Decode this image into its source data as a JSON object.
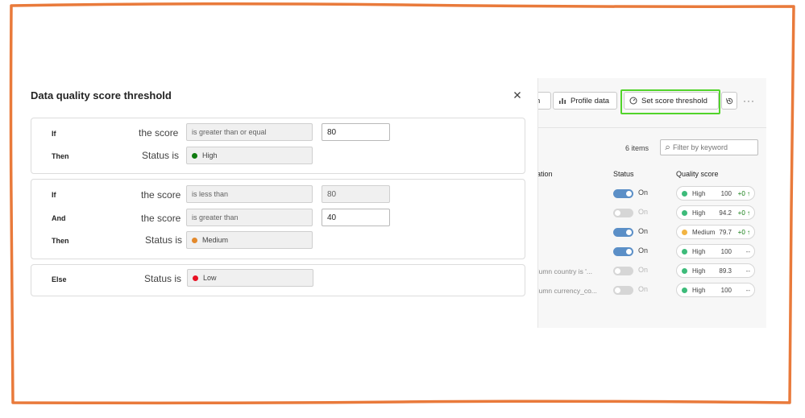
{
  "dialog": {
    "title": "Data quality score threshold",
    "rules": [
      {
        "lines": [
          {
            "keyword": "If",
            "label": "the score",
            "condition": "is greater than or equal",
            "value": "80",
            "value_editable": true
          },
          {
            "keyword": "Then",
            "label": "Status is",
            "status": "High",
            "status_color": "#107c10"
          }
        ]
      },
      {
        "lines": [
          {
            "keyword": "If",
            "label": "the score",
            "condition": "is less than",
            "value": "80",
            "value_editable": false
          },
          {
            "keyword": "And",
            "label": "the score",
            "condition": "is greater than",
            "value": "40",
            "value_editable": true
          },
          {
            "keyword": "Then",
            "label": "Status is",
            "status": "Medium",
            "status_color": "#e3892b"
          }
        ]
      },
      {
        "lines": [
          {
            "keyword": "Else",
            "label": "Status is",
            "status": "Low",
            "status_color": "#e81123"
          }
        ]
      }
    ]
  },
  "background": {
    "toolbar": {
      "partial_button": "n",
      "profile_data": "Profile data",
      "set_score_threshold": "Set score threshold",
      "more": "···"
    },
    "items_count": "6 items",
    "filter_placeholder": "Filter by keyword",
    "columns": {
      "description": "ation",
      "status": "Status",
      "quality_score": "Quality score"
    },
    "rows": [
      {
        "desc": "",
        "on": true,
        "status_text": "On",
        "level": "High",
        "score": "100",
        "trend": "+0 ↑",
        "dot": "#3dbb7a"
      },
      {
        "desc": "",
        "on": false,
        "status_text": "On",
        "level": "High",
        "score": "94.2",
        "trend": "+0 ↑",
        "dot": "#3dbb7a"
      },
      {
        "desc": "",
        "on": true,
        "status_text": "On",
        "level": "Medium",
        "score": "79.7",
        "trend": "+0 ↑",
        "dot": "#f2b443"
      },
      {
        "desc": "",
        "on": true,
        "status_text": "On",
        "level": "High",
        "score": "100",
        "trend": "--",
        "dot": "#3dbb7a"
      },
      {
        "desc": "olumn country is '...",
        "on": false,
        "status_text": "On",
        "level": "High",
        "score": "89.3",
        "trend": "--",
        "dot": "#3dbb7a"
      },
      {
        "desc": "olumn currency_co...",
        "on": false,
        "status_text": "On",
        "level": "High",
        "score": "100",
        "trend": "--",
        "dot": "#3dbb7a"
      }
    ]
  },
  "colors": {
    "frame_border": "#e97a3b",
    "highlight": "#52d42b",
    "toggle_on": "#5b8fc7",
    "toggle_off": "#d6d6d6",
    "trend_up": "#107c10"
  }
}
